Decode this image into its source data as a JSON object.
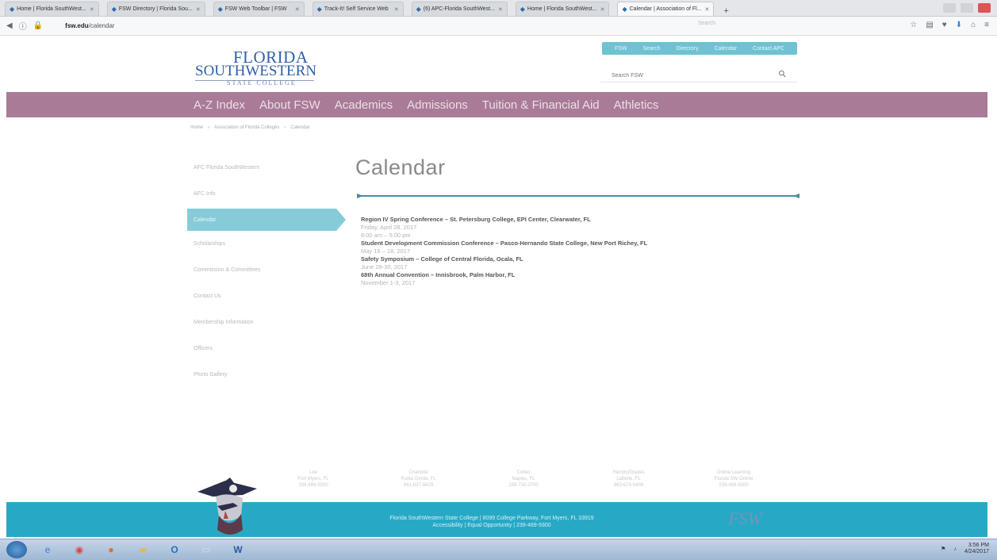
{
  "browser": {
    "tabs": [
      {
        "label": "Home | Florida SouthWest..."
      },
      {
        "label": "FSW Directory | Florida Sou..."
      },
      {
        "label": "FSW Web Toolbar | FSW"
      },
      {
        "label": "Track-It! Self Service Web"
      },
      {
        "label": "(6) APC-Florida SouthWest..."
      },
      {
        "label": "Home | Florida SouthWest..."
      },
      {
        "label": "Calendar | Association of Fl..."
      }
    ],
    "new_tab": "+",
    "url_domain": "fsw.edu",
    "url_path": "/calendar",
    "find_placeholder": "Search"
  },
  "site": {
    "logo": {
      "line1": "FLORIDA",
      "line2a": "SOUTH",
      "line2b": "WESTERN",
      "line3": "STATE COLLEGE"
    },
    "utility_links": [
      "FSW",
      "Search",
      "Directory",
      "Calendar",
      "Contact APC"
    ],
    "search_placeholder": "Search FSW",
    "main_nav": [
      "A-Z Index",
      "About FSW",
      "Academics",
      "Admissions",
      "Tuition & Financial Aid",
      "Athletics"
    ],
    "breadcrumb": [
      "Home",
      "Association of Florida Colleges",
      "Calendar"
    ],
    "sidebar": [
      {
        "label": "AFC Florida SouthWestern",
        "active": false
      },
      {
        "label": "AFC Info",
        "active": false
      },
      {
        "label": "Calendar",
        "active": true
      },
      {
        "label": "Scholarships",
        "active": false
      },
      {
        "label": "Commission & Committees",
        "active": false
      },
      {
        "label": "Contact Us",
        "active": false
      },
      {
        "label": "Membership Information",
        "active": false
      },
      {
        "label": "Officers",
        "active": false
      },
      {
        "label": "Photo Gallery",
        "active": false
      }
    ],
    "page_title": "Calendar",
    "events": [
      {
        "title": "Region IV Spring Conference – St. Petersburg College, EPI Center, Clearwater, FL",
        "date": "Friday, April 28, 2017",
        "time": "8:00 am – 5:00 pm"
      },
      {
        "title": "Student Development Commission Conference – Pasco-Hernando State College, New Port Richey, FL",
        "date": "May 16 – 18, 2017",
        "time": ""
      },
      {
        "title": "Safety Symposium – College of Central Florida, Ocala, FL",
        "date": "June 29-30, 2017",
        "time": ""
      },
      {
        "title": "68th Annual Convention – Innisbrook, Palm Harbor, FL",
        "date": "November 1-3, 2017",
        "time": ""
      }
    ],
    "footer_campuses": [
      {
        "name": "Lee",
        "city": "Fort Myers, FL",
        "phone": "239-489-9300"
      },
      {
        "name": "Charlotte",
        "city": "Punta Gorda, FL",
        "phone": "941-637-5629"
      },
      {
        "name": "Collier",
        "city": "Naples, FL",
        "phone": "239-732-3700"
      },
      {
        "name": "Hendry/Glades",
        "city": "LaBelle, FL",
        "phone": "863-674-0408"
      },
      {
        "name": "Online Learning",
        "city": "Florida SW Online",
        "phone": "239-489-9300"
      }
    ],
    "footer_line1": "Florida SouthWestern State College | 8099 College Parkway, Fort Myers, FL 33919",
    "footer_line2": "Accessibility | Equal Opportunity | 239-489-9300",
    "footer_logo": "FSW"
  },
  "taskbar": {
    "apps": [
      "windows-explorer",
      "chrome",
      "firefox",
      "files",
      "outlook",
      "word",
      "excel"
    ],
    "clock_time": "3:56 PM",
    "clock_date": "4/24/2017"
  }
}
